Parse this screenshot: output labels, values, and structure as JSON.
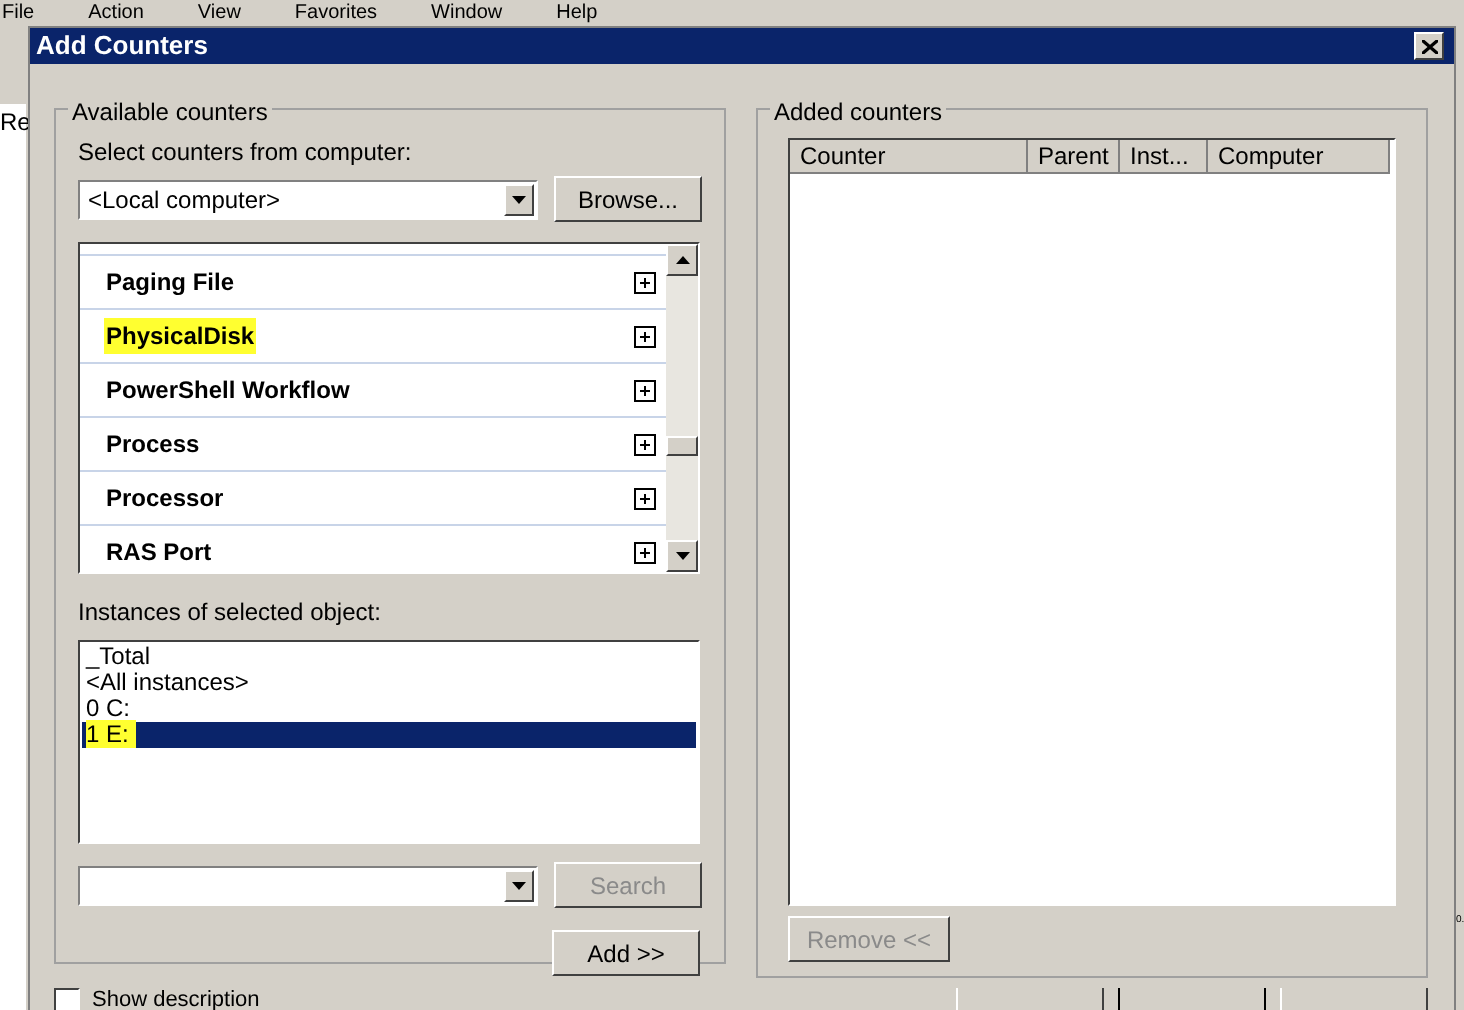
{
  "background_window": {
    "menu": [
      "File",
      "Action",
      "View",
      "Favorites",
      "Window",
      "Help"
    ],
    "sidebar_text": "Re",
    "right_fragment": "0."
  },
  "dialog": {
    "title": "Add Counters",
    "available_counters": {
      "title": "Available counters",
      "computer_label": "Select counters from computer:",
      "computer": "<Local computer>",
      "browse_button": "Browse...",
      "counters": [
        {
          "label": "Paging File",
          "highlighted": false
        },
        {
          "label": "PhysicalDisk",
          "highlighted": true
        },
        {
          "label": "PowerShell Workflow",
          "highlighted": false
        },
        {
          "label": "Process",
          "highlighted": false
        },
        {
          "label": "Processor",
          "highlighted": false
        },
        {
          "label": "RAS Port",
          "highlighted": false
        }
      ],
      "instances_label": "Instances of selected object:",
      "instances": [
        {
          "label": "_Total",
          "selected": false,
          "highlighted": false
        },
        {
          "label": "<All instances>",
          "selected": false,
          "highlighted": false
        },
        {
          "label": "0 C:",
          "selected": false,
          "highlighted": false
        },
        {
          "label": "1 E:",
          "selected": true,
          "highlighted": true
        }
      ],
      "search_button": {
        "label": "Search",
        "disabled": true
      },
      "add_button": "Add >>"
    },
    "added_counters": {
      "title": "Added counters",
      "columns": [
        "Counter",
        "Parent",
        "Inst...",
        "Computer"
      ],
      "remove_button": {
        "label": "Remove <<",
        "disabled": true
      }
    },
    "show_description": {
      "label": "Show description",
      "checked": false
    }
  }
}
